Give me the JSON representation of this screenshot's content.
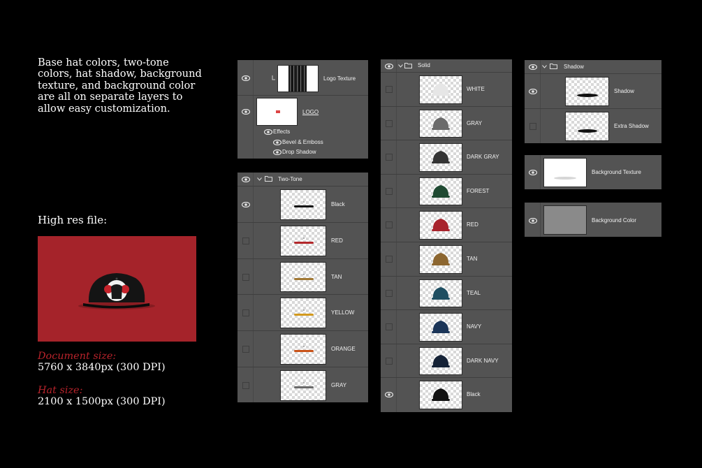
{
  "intro": {
    "lines": [
      "Base hat colors, two-tone",
      "colors, hat shadow, background",
      "texture, and background color",
      "are all on separate layers to",
      "allow easy customization."
    ]
  },
  "high_res_label": "High res file:",
  "document_size": {
    "label": "Document size:",
    "value": "5760 x 3840px (300 DPI)"
  },
  "hat_size": {
    "label": "Hat size:",
    "value": "2100 x 1500px (300 DPI)"
  },
  "colors": {
    "preview_bg": "#a5232a",
    "accent_text": "#b8232b",
    "panel": "#535353"
  },
  "logo_panel": {
    "layers": [
      {
        "name": "Logo Texture",
        "visible": true
      },
      {
        "name": "LOGO",
        "visible": true
      }
    ],
    "effects_label": "Effects",
    "effects": [
      "Bevel & Emboss",
      "Drop Shadow"
    ]
  },
  "two_tone": {
    "group_name": "Two-Tone",
    "layers": [
      {
        "name": "Black",
        "visible": true,
        "color": "#111111"
      },
      {
        "name": "RED",
        "visible": false,
        "color": "#b3282b"
      },
      {
        "name": "TAN",
        "visible": false,
        "color": "#a17833"
      },
      {
        "name": "YELLOW",
        "visible": false,
        "color": "#d39a1e"
      },
      {
        "name": "ORANGE",
        "visible": false,
        "color": "#c9541a"
      },
      {
        "name": "GRAY",
        "visible": false,
        "color": "#6a6a6a"
      }
    ]
  },
  "solid": {
    "group_name": "Solid",
    "layers": [
      {
        "name": "WHITE",
        "visible": false,
        "color": "#e6e6e6"
      },
      {
        "name": "GRAY",
        "visible": false,
        "color": "#6b6b6b"
      },
      {
        "name": "DARK GRAY",
        "visible": false,
        "color": "#353535"
      },
      {
        "name": "FOREST",
        "visible": false,
        "color": "#1f4a32"
      },
      {
        "name": "RED",
        "visible": false,
        "color": "#a8232c"
      },
      {
        "name": "TAN",
        "visible": false,
        "color": "#8c6630"
      },
      {
        "name": "TEAL",
        "visible": false,
        "color": "#1e4e61"
      },
      {
        "name": "NAVY",
        "visible": false,
        "color": "#1b3558"
      },
      {
        "name": "DARK NAVY",
        "visible": false,
        "color": "#152236"
      },
      {
        "name": "Black",
        "visible": true,
        "color": "#111111"
      }
    ]
  },
  "shadow_group": {
    "group_name": "Shadow",
    "layers": [
      {
        "name": "Shadow",
        "visible": true
      },
      {
        "name": "Extra Shadow",
        "visible": false
      }
    ]
  },
  "background_texture": {
    "name": "Background Texture",
    "visible": true
  },
  "background_color": {
    "name": "Background Color",
    "visible": true,
    "color": "#8a8a8a"
  }
}
